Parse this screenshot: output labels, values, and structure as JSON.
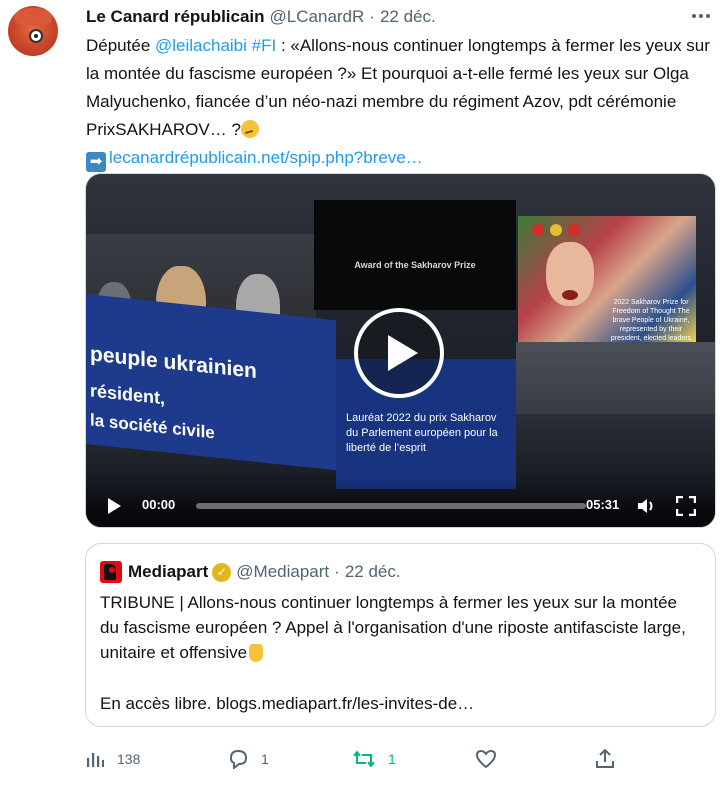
{
  "tweet": {
    "author_name": "Le Canard républicain",
    "handle": "@LCanardR",
    "separator": "·",
    "date": "22 déc.",
    "text": {
      "t1": "Députée ",
      "mention": "@leilachaibi",
      "space": " ",
      "hashtag": "#FI",
      "t2": " : «Allons-nous continuer longtemps à fermer les yeux sur la montée du fascisme européen ?» Et pourquoi a-t-elle fermé les yeux sur Olga Malyuchenko, fiancée d’un néo-nazi membre du régiment Azov, pdt cérémonie PrixSAKHAROV… ?",
      "link": "lecanardrépublicain.net/spip.php?breve…"
    },
    "more_icon": "more-horizontal-icon"
  },
  "video": {
    "screen_title": "Award of the Sakharov Prize",
    "screen_caption": "2022 Sakharov Prize for Freedom of Thought The brave People of Ukraine, represented by their president, elected leaders and civil society.",
    "banner_line1": "peuple ukrainien",
    "banner_line2": "résident,",
    "banner_line3": "la société civile",
    "banner_right": "Lauréat 2022 du prix Sakharov du Parlement européen pour la liberté de l’esprit",
    "current_time": "00:00",
    "duration": "05:31",
    "progress_fraction": 0,
    "icons": [
      "play-icon",
      "volume-icon",
      "fullscreen-icon"
    ]
  },
  "quoted": {
    "name": "Mediapart",
    "handle": "@Mediapart",
    "separator": "·",
    "date": "22 déc.",
    "verified_icon": "gold-verified-badge-icon",
    "text": "TRIBUNE | Allons-nous continuer longtemps à fermer les yeux sur la montée du fascisme européen ? Appel à l'organisation d'une riposte antifasciste large, unitaire et offensive",
    "link_line": "En accès libre. blogs.mediapart.fr/les-invites-de…"
  },
  "actions": {
    "views": "138",
    "replies": "1",
    "retweets": "1",
    "retweet_color": "#00ba7c",
    "link_color": "#1d9bf0"
  }
}
